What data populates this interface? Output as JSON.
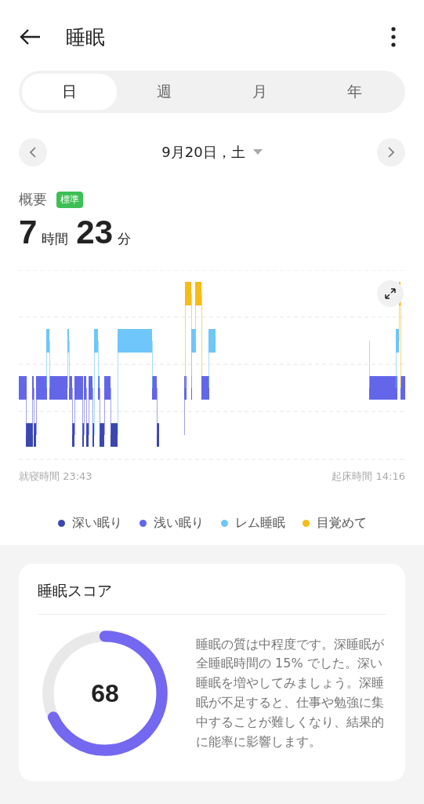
{
  "header": {
    "title": "睡眠"
  },
  "tabs": [
    {
      "label": "日",
      "selected": true
    },
    {
      "label": "週",
      "selected": false
    },
    {
      "label": "月",
      "selected": false
    },
    {
      "label": "年",
      "selected": false
    }
  ],
  "date_nav": {
    "label": "9月20日，土"
  },
  "summary": {
    "label": "概要",
    "badge": "標準",
    "hours": "7",
    "hours_unit": "時間",
    "minutes": "23",
    "minutes_unit": "分"
  },
  "hypnogram": {
    "bedtime": "就寝時間 23:43",
    "wake_time": "起床時間 14:16"
  },
  "legend": [
    {
      "label": "深い眠り",
      "color": "#3b47b0"
    },
    {
      "label": "浅い眠り",
      "color": "#6366e8"
    },
    {
      "label": "レム睡眠",
      "color": "#6ec6fa"
    },
    {
      "label": "目覚めて",
      "color": "#f7bb16"
    }
  ],
  "score_card": {
    "title": "睡眠スコア",
    "score": "68",
    "description": "睡眠の質は中程度です。深睡眠が全睡眠時間の 15% でした。深い睡眠を増やしてみましょう。深睡眠が不足すると、仕事や勉強に集中することが難しくなり、結果的に能率に影響します。"
  }
}
